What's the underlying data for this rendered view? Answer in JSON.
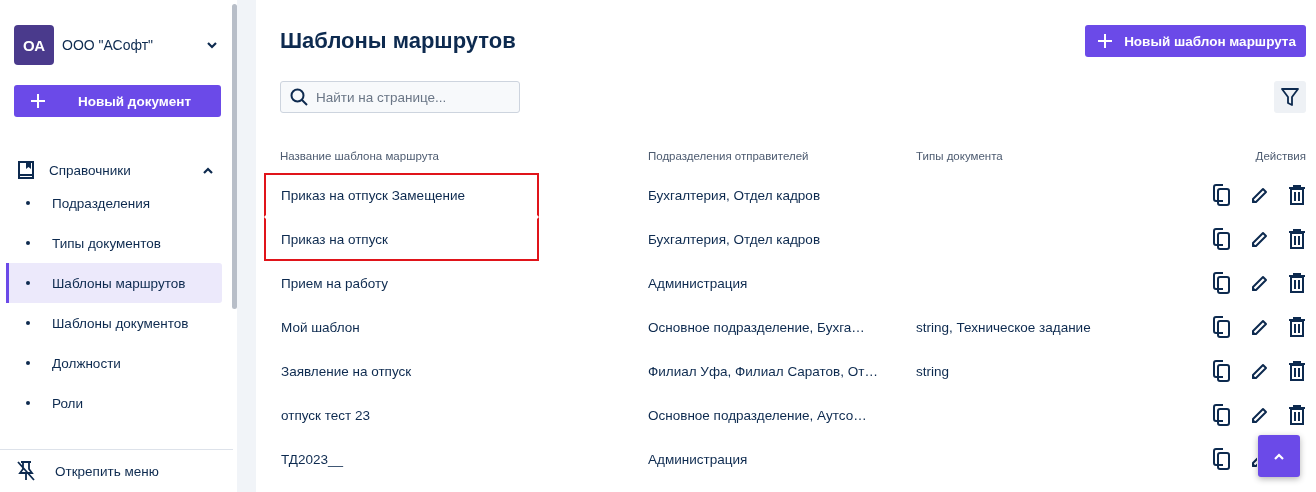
{
  "sidebar": {
    "org": {
      "initials": "ОА",
      "name": "ООО \"АСофт\"",
      "expanded": false
    },
    "new_button": "Новый документ",
    "section": {
      "label": "Справочники",
      "expanded": true,
      "items": [
        {
          "label": "Подразделения",
          "selected": false
        },
        {
          "label": "Типы документов",
          "selected": false
        },
        {
          "label": "Шаблоны маршрутов",
          "selected": true
        },
        {
          "label": "Шаблоны документов",
          "selected": false
        },
        {
          "label": "Должности",
          "selected": false
        },
        {
          "label": "Роли",
          "selected": false
        }
      ]
    },
    "footer": "Открепить меню"
  },
  "main": {
    "title": "Шаблоны маршрутов",
    "new_button": "Новый шаблон маршрута",
    "search": {
      "placeholder": "Найти на странице..."
    },
    "table": {
      "columns": [
        "Название шаблона маршрута",
        "Подразделения отправителей",
        "Типы документа",
        "Действия"
      ],
      "rows": [
        {
          "name": "Приказ на отпуск Замещение",
          "departments": "Бухгалтерия, Отдел кадров",
          "types": "",
          "highlighted": true
        },
        {
          "name": "Приказ на отпуск",
          "departments": "Бухгалтерия, Отдел кадров",
          "types": "",
          "highlighted": true
        },
        {
          "name": "Прием на работу",
          "departments": "Администрация",
          "types": "",
          "highlighted": false
        },
        {
          "name": "Мой шаблон",
          "departments": "Основное подразделение, Бухга…",
          "types": "string, Техническое задание",
          "highlighted": false
        },
        {
          "name": "Заявление на отпуск",
          "departments": "Филиал Уфа, Филиал Саратов, От…",
          "types": "string",
          "highlighted": false
        },
        {
          "name": "отпуск тест 23",
          "departments": "Основное подразделение, Аутсо…",
          "types": "",
          "highlighted": false
        },
        {
          "name": "ТД2023__",
          "departments": "Администрация",
          "types": "",
          "highlighted": false
        }
      ]
    }
  }
}
